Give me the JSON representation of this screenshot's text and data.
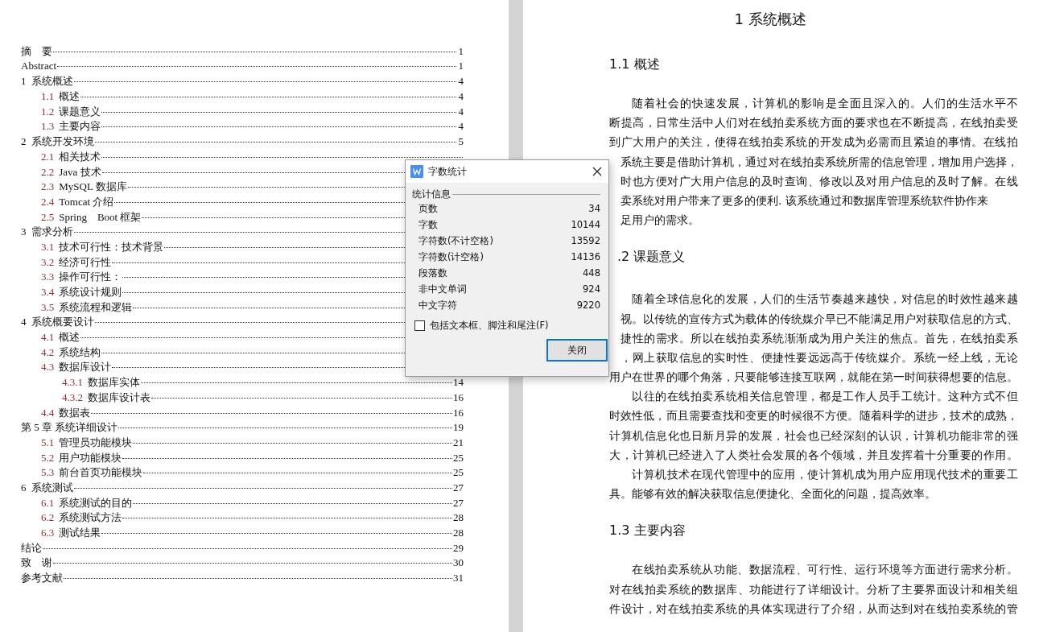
{
  "toc": {
    "entries": [
      {
        "title": "摘　要",
        "page": "1"
      },
      {
        "title": "Abstract",
        "page": "1"
      },
      {
        "num": "1",
        "title": "系统概述",
        "page": "4",
        "children": [
          {
            "num": "1.1",
            "title": "概述",
            "page": "4"
          },
          {
            "num": "1.2",
            "title": "课题意义",
            "page": "4"
          },
          {
            "num": "1.3",
            "title": "主要内容",
            "page": "4"
          }
        ]
      },
      {
        "num": "2",
        "title": "系统开发环境",
        "page": "5",
        "children": [
          {
            "num": "2.1",
            "title": "相关技术"
          },
          {
            "num": "2.2",
            "title": "Java 技术"
          },
          {
            "num": "2.3",
            "title": "MySQL 数据库"
          },
          {
            "num": "2.4",
            "title": "Tomcat 介绍"
          },
          {
            "num": "2.5",
            "title": "Spring　Boot 框架"
          }
        ]
      },
      {
        "num": "3",
        "title": "需求分析",
        "children": [
          {
            "num": "3.1",
            "title": "技术可行性：技术背景"
          },
          {
            "num": "3.2",
            "title": "经济可行性"
          },
          {
            "num": "3.3",
            "title": "操作可行性："
          },
          {
            "num": "3.4",
            "title": "系统设计规则"
          },
          {
            "num": "3.5",
            "title": "系统流程和逻辑"
          }
        ]
      },
      {
        "num": "4",
        "title": "系统概要设计",
        "children": [
          {
            "num": "4.1",
            "title": "概述"
          },
          {
            "num": "4.2",
            "title": "系统结构"
          },
          {
            "num": "4.3",
            "title": "数据库设计",
            "children": [
              {
                "num": "4.3.1",
                "title": "数据库实体",
                "page": "14"
              },
              {
                "num": "4.3.2",
                "title": "数据库设计表",
                "page": "16"
              }
            ]
          },
          {
            "num": "4.4",
            "title": "数据表",
            "page": "16"
          }
        ]
      },
      {
        "title": "第 5 章  系统详细设计",
        "page": "19",
        "children": [
          {
            "num": "5.1",
            "title": "管理员功能模块",
            "page": "21"
          },
          {
            "num": "5.2",
            "title": "用户功能模块",
            "page": "25"
          },
          {
            "num": "5.3",
            "title": "前台首页功能模块",
            "page": "25"
          }
        ]
      },
      {
        "num": "6",
        "title": "系统测试",
        "page": "27",
        "children": [
          {
            "num": "6.1",
            "title": "系统测试的目的",
            "page": "27"
          },
          {
            "num": "6.2",
            "title": "系统测试方法",
            "page": "28"
          },
          {
            "num": "6.3",
            "title": "测试结果",
            "page": "28"
          }
        ]
      },
      {
        "title": "结论",
        "page": "29"
      },
      {
        "title": "致　谢",
        "page": "30"
      },
      {
        "title": "参考文献",
        "page": "31"
      }
    ]
  },
  "page": {
    "blocks": [
      {
        "kind": "chapter",
        "text": "1  系统概述"
      },
      {
        "kind": "heading",
        "text": "1.1  概述"
      },
      {
        "kind": "paragraph",
        "lines": [
          {
            "kind": "first",
            "text": "随着社会的快速发展，计算机的影响是全面且深入的。人们的生活水平不"
          },
          {
            "kind": "full",
            "text": "断提高，日常生活中人们对在线拍卖系统方面的要求也在不断提高，在线拍卖受"
          },
          {
            "kind": "full",
            "text": "到广大用户的关注，使得在线拍卖系统的开发成为必需而且紧迫的事情。在线拍"
          },
          {
            "kind": "cut",
            "text": "系统主要是借助计算机，通过对在线拍卖系统所需的信息管理，增加用户选择，"
          },
          {
            "kind": "cut",
            "text": "时也方便对广大用户信息的及时查询、修改以及对用户信息的及时了解。在线"
          },
          {
            "kind": "cutend",
            "text": "卖系统对用户带来了更多的便利. 该系统通过和数据库管理系统软件协作来"
          },
          {
            "kind": "cutend",
            "text": "足用户的需求。"
          }
        ]
      },
      {
        "kind": "cutheading",
        "text": ".2 课题意义"
      },
      {
        "kind": "paragraph",
        "lines": [
          {
            "kind": "first",
            "text": "随着全球信息化的发展，人们的生活节奏越来越快，对信息的时效性越来越"
          },
          {
            "kind": "cut",
            "text": "视。以传统的宣传方式为载体的传统媒介早已不能满足用户对获取信息的方式、"
          },
          {
            "kind": "cut",
            "text": "捷性的需求。所以在线拍卖系统渐渐成为用户关注的焦点。首先，在线拍卖系"
          },
          {
            "kind": "cut",
            "text": "，网上获取信息的实时性、便捷性要远远高于传统媒介。系统一经上线，无论"
          },
          {
            "kind": "full",
            "text": "用户在世界的哪个角落，只要能够连接互联网，就能在第一时间获得想要的信息。"
          }
        ]
      },
      {
        "kind": "paragraph",
        "lines": [
          {
            "kind": "first",
            "text": "以往的在线拍卖系统相关信息管理，都是工作人员手工统计。这种方式不但"
          },
          {
            "kind": "full",
            "text": "时效性低，而且需要查找和变更的时候很不方便。随着科学的进步，技术的成熟，"
          },
          {
            "kind": "full",
            "text": "计算机信息化也日新月异的发展，社会也已经深刻的认识，计算机功能非常的强"
          },
          {
            "kind": "full",
            "text": "大，计算机已经进入了人类社会发展的各个领域，并且发挥着十分重要的作用。"
          }
        ]
      },
      {
        "kind": "paragraph",
        "lines": [
          {
            "kind": "first",
            "text": "计算机技术在现代管理中的应用，使计算机成为用户应用现代技术的重要工"
          },
          {
            "kind": "last",
            "text": "具。能够有效的解决获取信息便捷化、全面化的问题，提高效率。"
          }
        ]
      },
      {
        "kind": "heading",
        "text": "1.3  主要内容"
      },
      {
        "kind": "paragraph",
        "lines": [
          {
            "kind": "first",
            "text": "在线拍卖系统从功能、数据流程、可行性、运行环境等方面进行需求分析。"
          },
          {
            "kind": "full",
            "text": "对在线拍卖系统的数据库、功能进行了详细设计。分析了主要界面设计和相关组"
          },
          {
            "kind": "full",
            "text": "件设计，对在线拍卖系统的具体实现进行了介绍，从而达到对在线拍卖系统的管"
          }
        ]
      }
    ]
  },
  "dialog": {
    "title": "字数统计",
    "group": "统计信息",
    "stats": [
      {
        "label": "页数",
        "value": "34"
      },
      {
        "label": "字数",
        "value": "10144"
      },
      {
        "label": "字符数(不计空格)",
        "value": "13592"
      },
      {
        "label": "字符数(计空格)",
        "value": "14136"
      },
      {
        "label": "段落数",
        "value": "448"
      },
      {
        "label": "非中文单词",
        "value": "924"
      },
      {
        "label": "中文字符",
        "value": "9220"
      }
    ],
    "checkbox": {
      "label": "包括文本框、脚注和尾注(F)",
      "checked": false
    },
    "button": "关闭"
  }
}
